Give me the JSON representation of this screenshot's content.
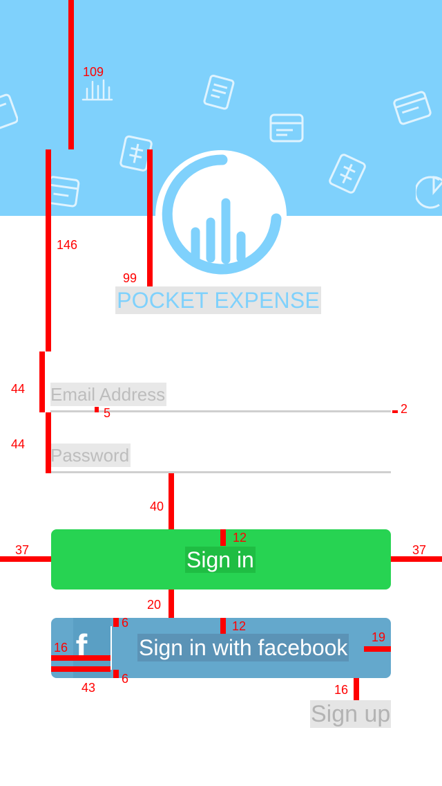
{
  "brand": {
    "title": "POCKET EXPENSE"
  },
  "form": {
    "email_placeholder": "Email Address",
    "password_placeholder": "Password"
  },
  "buttons": {
    "signin_label": "Sign in",
    "facebook_label": "Sign in with facebook",
    "facebook_icon_letter": "f",
    "signup_label": "Sign up"
  },
  "colors": {
    "header_blue": "#7fd1fc",
    "signin_green": "#27d352",
    "facebook_blue": "#64a8cc",
    "measure_red": "#ff0000"
  },
  "icons": [
    "bar-chart-icon",
    "receipt-icon",
    "card-icon",
    "pie-chart-icon",
    "logo-chart-icon",
    "facebook-icon"
  ],
  "measurements": {
    "m109": "109",
    "m146": "146",
    "m99": "99",
    "m44a": "44",
    "m44b": "44",
    "m5": "5",
    "m2": "2",
    "m40": "40",
    "m12a": "12",
    "m37l": "37",
    "m37r": "37",
    "m20": "20",
    "m12b": "12",
    "m6t": "6",
    "m6b": "6",
    "m16l": "16",
    "m19": "19",
    "m43": "43",
    "m16r": "16"
  }
}
